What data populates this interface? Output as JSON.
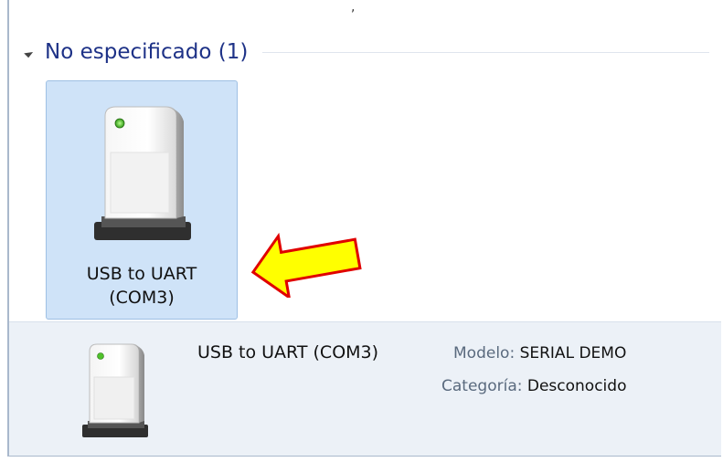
{
  "group": {
    "title": "No especificado (1)"
  },
  "device": {
    "tile_label_line1": "USB to UART",
    "tile_label_line2": "(COM3)",
    "icon": "storage-drive-icon"
  },
  "details": {
    "name": "USB to UART (COM3)",
    "model_key": "Modelo:",
    "model_value": "SERIAL DEMO",
    "category_key": "Categoría:",
    "category_value": "Desconocido"
  },
  "annotation": {
    "arrow_icon": "yellow-arrow-icon",
    "arrow_fill": "#ffff00",
    "arrow_stroke": "#e00000"
  },
  "colors": {
    "group_title": "#1e3287",
    "selection_bg": "#cfe3f8",
    "details_bg": "#ecf1f7"
  }
}
